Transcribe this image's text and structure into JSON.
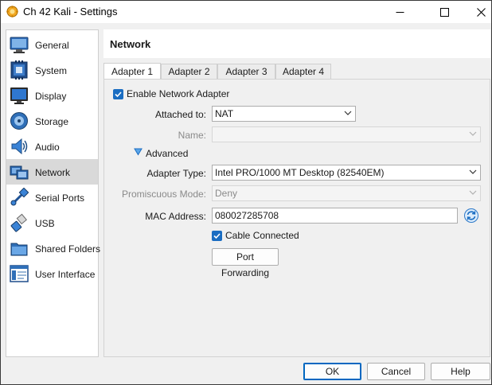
{
  "window": {
    "title": "Ch 42 Kali - Settings"
  },
  "sidebar": {
    "items": [
      {
        "label": "General",
        "icon": "general-icon"
      },
      {
        "label": "System",
        "icon": "system-icon"
      },
      {
        "label": "Display",
        "icon": "display-icon"
      },
      {
        "label": "Storage",
        "icon": "storage-icon"
      },
      {
        "label": "Audio",
        "icon": "audio-icon"
      },
      {
        "label": "Network",
        "icon": "network-icon",
        "selected": true
      },
      {
        "label": "Serial Ports",
        "icon": "serial-ports-icon"
      },
      {
        "label": "USB",
        "icon": "usb-icon"
      },
      {
        "label": "Shared Folders",
        "icon": "shared-folders-icon"
      },
      {
        "label": "User Interface",
        "icon": "user-interface-icon"
      }
    ]
  },
  "main": {
    "title": "Network",
    "tabs": [
      {
        "label": "Adapter 1",
        "active": true
      },
      {
        "label": "Adapter 2"
      },
      {
        "label": "Adapter 3"
      },
      {
        "label": "Adapter 4"
      }
    ],
    "enable_adapter": {
      "label": "Enable Network Adapter",
      "checked": true
    },
    "attached_to": {
      "label": "Attached to:",
      "value": "NAT"
    },
    "name": {
      "label": "Name:",
      "value": ""
    },
    "advanced": {
      "label": "Advanced",
      "expanded": true
    },
    "adapter_type": {
      "label": "Adapter Type:",
      "value": "Intel PRO/1000 MT Desktop (82540EM)"
    },
    "promiscuous_mode": {
      "label": "Promiscuous Mode:",
      "value": "Deny"
    },
    "mac_address": {
      "label": "MAC Address:",
      "value": "080027285708"
    },
    "cable_connected": {
      "label": "Cable Connected",
      "checked": true
    },
    "port_forwarding": {
      "label": "Port Forwarding"
    }
  },
  "footer": {
    "ok": "OK",
    "cancel": "Cancel",
    "help": "Help"
  },
  "colors": {
    "accent": "#1a6dc2",
    "selected_row": "#d9d9d9",
    "window_bg": "#f0f0f0"
  }
}
